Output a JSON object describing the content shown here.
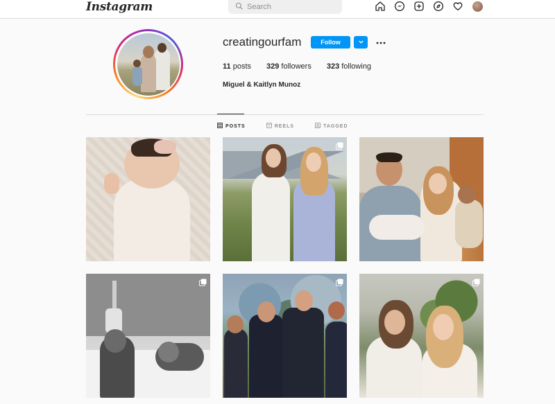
{
  "header": {
    "logo": "Instagram",
    "search_placeholder": "Search",
    "nav_icons": [
      "home-icon",
      "messenger-icon",
      "new-post-icon",
      "explore-icon",
      "activity-heart-icon",
      "profile-avatar"
    ]
  },
  "profile": {
    "username": "creatingourfam",
    "follow_label": "Follow",
    "posts_count": "11",
    "posts_label": "posts",
    "followers_count": "329",
    "followers_label": "followers",
    "following_count": "323",
    "following_label": "following",
    "full_name": "Miguel & Kaitlyn Munoz"
  },
  "tabs": [
    {
      "label": "POSTS",
      "icon": "grid-icon",
      "active": true
    },
    {
      "label": "REELS",
      "icon": "reels-icon",
      "active": false
    },
    {
      "label": "TAGGED",
      "icon": "tagged-icon",
      "active": false
    }
  ],
  "colors": {
    "accent": "#0095f6",
    "text": "#262626",
    "muted": "#8e8e8e",
    "background": "#fafafa"
  },
  "posts": [
    {
      "subject": "newborn-baby-with-bow",
      "multi": false
    },
    {
      "subject": "two-women-in-field",
      "multi": true
    },
    {
      "subject": "family-hospital-photo",
      "multi": false
    },
    {
      "subject": "black-white-hospital-room",
      "multi": true
    },
    {
      "subject": "group-outdoor-tshirts",
      "multi": true
    },
    {
      "subject": "two-women-selfie",
      "multi": true
    }
  ]
}
